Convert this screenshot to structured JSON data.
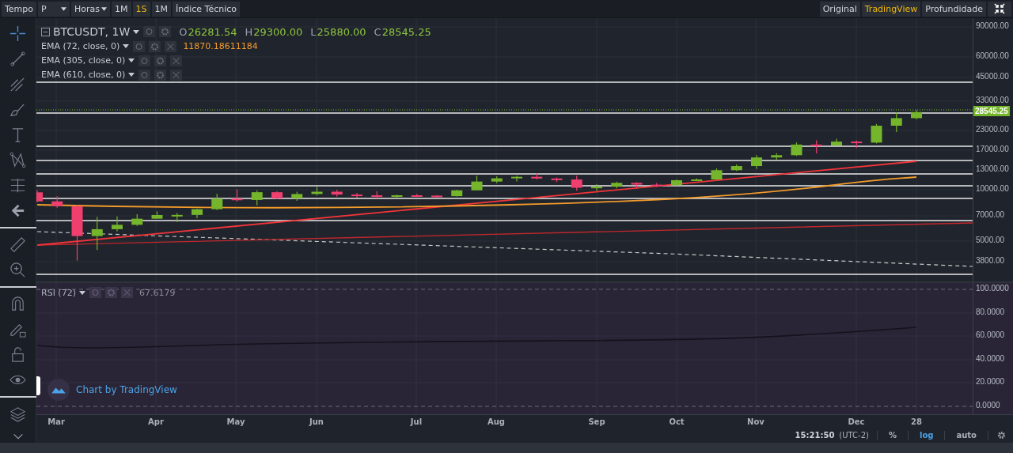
{
  "toolbar": {
    "label": "Tempo",
    "period_select": "P",
    "interval_dropdown": "Horas",
    "intervals": [
      {
        "label": "1M",
        "selected": false
      },
      {
        "label": "1S",
        "selected": true
      },
      {
        "label": "1M",
        "selected": false
      }
    ],
    "indicators_button": "Índice Técnico",
    "views": [
      {
        "label": "Original",
        "selected": false
      },
      {
        "label": "TradingView",
        "selected": true
      },
      {
        "label": "Profundidade",
        "selected": false
      }
    ]
  },
  "legend": {
    "symbol": "BTCUSDT, 1W",
    "ohlc": [
      {
        "key": "O",
        "value": "26281.54"
      },
      {
        "key": "H",
        "value": "29300.00"
      },
      {
        "key": "L",
        "value": "25880.00"
      },
      {
        "key": "C",
        "value": "28545.25"
      }
    ],
    "indicators": [
      {
        "name": "EMA (72, close, 0)",
        "value": "11870.18611184"
      },
      {
        "name": "EMA (305, close, 0)"
      },
      {
        "name": "EMA (610, close, 0)"
      }
    ]
  },
  "price_axis": {
    "ticks": [
      "90000.00",
      "60000.00",
      "45000.00",
      "33000.00",
      "23000.00",
      "17000.00",
      "13000.00",
      "10000.00",
      "7000.00",
      "5000.00",
      "3800.00"
    ],
    "last_price": "28545.25"
  },
  "rsi": {
    "name": "RSI (72)",
    "value": "67.6179",
    "ticks": [
      "100.0000",
      "80.0000",
      "60.0000",
      "40.0000",
      "20.0000",
      "0.0000"
    ],
    "branding": "Chart by TradingView"
  },
  "time_axis": [
    "Mar",
    "Apr",
    "May",
    "Jun",
    "Jul",
    "Aug",
    "Sep",
    "Oct",
    "Nov",
    "Dec",
    "28"
  ],
  "status_bar": {
    "time": "15:21:50",
    "timezone": "(UTC-2)",
    "scale_buttons": [
      {
        "label": "%",
        "selected": false
      },
      {
        "label": "log",
        "selected": true
      },
      {
        "label": "auto",
        "selected": false
      }
    ]
  }
}
